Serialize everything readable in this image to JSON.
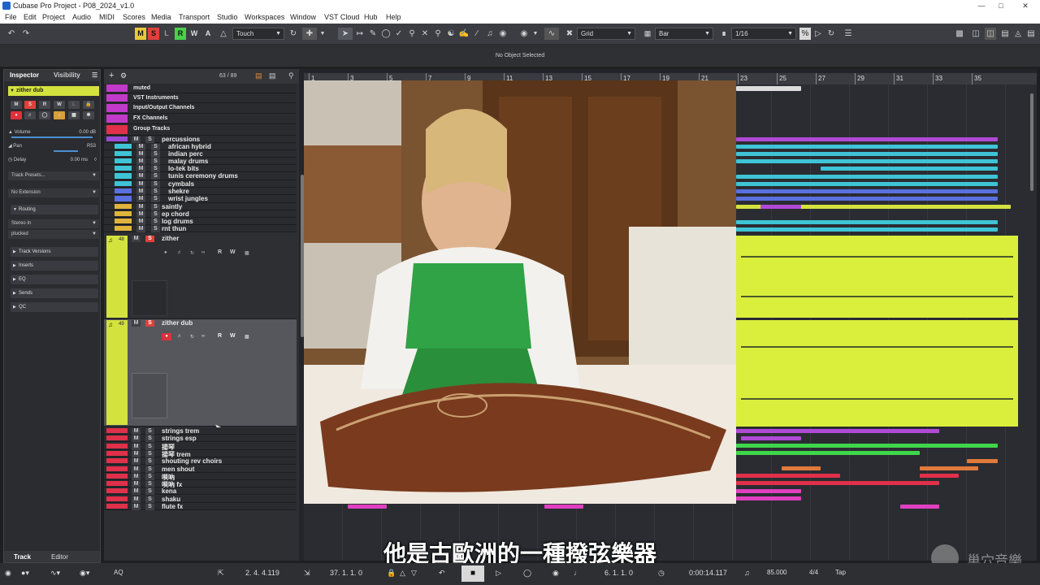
{
  "window": {
    "title": "Cubase Pro Project - P08_2024_v1.0"
  },
  "menu": [
    "File",
    "Edit",
    "Project",
    "Audio",
    "MIDI",
    "Scores",
    "Media",
    "Transport",
    "Studio",
    "Workspaces",
    "Window",
    "VST Cloud",
    "Hub",
    "Help"
  ],
  "toolbar": {
    "mode_buttons": [
      "M",
      "S",
      "L",
      "R",
      "W",
      "A"
    ],
    "automation_mode": "Touch",
    "grid_type": "Grid",
    "grid_unit": "Bar",
    "quantize": "1/16"
  },
  "infoline": {
    "status": "No Object Selected"
  },
  "inspector": {
    "tab_inspector": "Inspector",
    "tab_visibility": "Visibility",
    "track_name": "zither dub",
    "volume_label": "Volume",
    "volume_value": "0.00 dB",
    "pan_label": "Pan",
    "pan_value": "R53",
    "delay_label": "Delay",
    "delay_value": "0.00 ms",
    "track_presets": "Track Presets...",
    "extension": "No Extension",
    "routing": "Routing",
    "input": "Stereo In",
    "output": "plucked",
    "sections": [
      "Track Versions",
      "Inserts",
      "EQ",
      "Sends",
      "QC"
    ],
    "bottom_tab_track": "Track",
    "bottom_tab_editor": "Editor"
  },
  "tracklist": {
    "counter": "63 / 89",
    "tracks": [
      {
        "name": "muted",
        "color": "#c23ac9",
        "num": ""
      },
      {
        "name": "VST Instruments",
        "color": "#c23ac9",
        "num": ""
      },
      {
        "name": "Input/Output Channels",
        "color": "#c23ac9",
        "num": ""
      },
      {
        "name": "FX Channels",
        "color": "#c23ac9",
        "num": ""
      },
      {
        "name": "Group Tracks",
        "color": "#e0304a",
        "num": ""
      },
      {
        "name": "percussions",
        "color": "#9a4ad6",
        "num": ""
      },
      {
        "name": "african hybrid",
        "color": "#3ec4d6",
        "num": ""
      },
      {
        "name": "indian perc",
        "color": "#3ec4d6",
        "num": ""
      },
      {
        "name": "malay drums",
        "color": "#3ec4d6",
        "num": ""
      },
      {
        "name": "lo-tek bits",
        "color": "#3ec4d6",
        "num": ""
      },
      {
        "name": "tunis ceremony drums",
        "color": "#3ec4d6",
        "num": ""
      },
      {
        "name": "cymbals",
        "color": "#3ec4d6",
        "num": ""
      },
      {
        "name": "shekre",
        "color": "#5a6fe0",
        "num": ""
      },
      {
        "name": "wrist jungles",
        "color": "#5a6fe0",
        "num": ""
      },
      {
        "name": "saintly",
        "color": "#e0b43c",
        "num": ""
      },
      {
        "name": "ep chord",
        "color": "#e0b43c",
        "num": ""
      },
      {
        "name": "log drums",
        "color": "#e0b43c",
        "num": ""
      },
      {
        "name": "rnt thun",
        "color": "#e0b43c",
        "num": ""
      }
    ],
    "zither": {
      "name": "zither",
      "num": "48"
    },
    "zither_dub": {
      "name": "zither dub",
      "num": "49"
    },
    "lower_tracks": [
      {
        "name": "strings trem",
        "color": "#e0304a"
      },
      {
        "name": "strings esp",
        "color": "#e0304a"
      },
      {
        "name": "揚琴",
        "color": "#e0304a"
      },
      {
        "name": "揚琴 trem",
        "color": "#e0304a"
      },
      {
        "name": "shouting rev  choirs",
        "color": "#e0304a"
      },
      {
        "name": "men shout",
        "color": "#e0304a"
      },
      {
        "name": "嗩吶",
        "color": "#e0304a"
      },
      {
        "name": "嗩吶 fx",
        "color": "#e0304a"
      },
      {
        "name": "kena",
        "color": "#e0304a"
      },
      {
        "name": "shaku",
        "color": "#e0304a"
      },
      {
        "name": "flute fx",
        "color": "#e0304a"
      }
    ],
    "track_btn_m": "M",
    "track_btn_s": "S",
    "track_btn_r": "R",
    "track_btn_w": "W"
  },
  "ruler": {
    "marks": [
      "1",
      "3",
      "5",
      "7",
      "9",
      "11",
      "13",
      "15",
      "17",
      "19",
      "21",
      "23",
      "25",
      "27",
      "29",
      "31",
      "33",
      "35"
    ]
  },
  "transport": {
    "left_locator": "2. 4. 4.119",
    "right_locator": "37. 1. 1.   0",
    "position_bars": "6. 1. 1.   0",
    "position_time": "0:00:14.117",
    "tempo": "85.000",
    "signature": "4/4",
    "tap": "Tap",
    "aq": "AQ"
  },
  "subtitle": "他是古歐洲的一種撥弦樂器",
  "watermark": "巢穴音樂"
}
